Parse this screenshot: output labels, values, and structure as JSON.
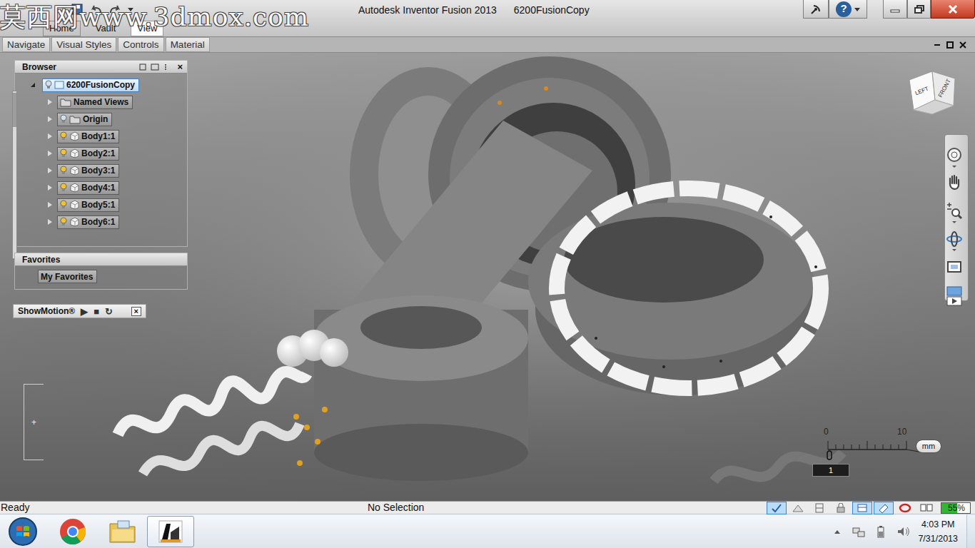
{
  "watermark": "莫西网www.3dmox.com",
  "window": {
    "app_title": "Autodesk Inventor Fusion 2013",
    "document": "6200FusionCopy",
    "help": "?"
  },
  "ribbon_tabs": [
    {
      "label": "Home",
      "selected": false
    },
    {
      "label": "Vault",
      "selected": false
    },
    {
      "label": "View",
      "selected": true
    }
  ],
  "panel_tabs": [
    "Navigate",
    "Visual Styles",
    "Controls",
    "Material"
  ],
  "browser": {
    "title": "Browser",
    "close": "×",
    "root": {
      "label": "6200FusionCopy",
      "expanded": true,
      "selected": true,
      "visible": false
    },
    "items": [
      {
        "label": "Named Views",
        "kind": "folder",
        "expanded": false,
        "selected": false
      },
      {
        "label": "Origin",
        "kind": "folder",
        "expanded": false,
        "selected": false,
        "visible": false
      },
      {
        "label": "Body1:1",
        "kind": "body",
        "expanded": false,
        "selected": false,
        "visible": true
      },
      {
        "label": "Body2:1",
        "kind": "body",
        "expanded": false,
        "selected": false,
        "visible": true
      },
      {
        "label": "Body3:1",
        "kind": "body",
        "expanded": false,
        "selected": false,
        "visible": true
      },
      {
        "label": "Body4:1",
        "kind": "body",
        "expanded": false,
        "selected": false,
        "visible": true
      },
      {
        "label": "Body5:1",
        "kind": "body",
        "expanded": false,
        "selected": false,
        "visible": true
      },
      {
        "label": "Body6:1",
        "kind": "body",
        "expanded": false,
        "selected": false,
        "visible": true
      }
    ]
  },
  "favorites": {
    "title": "Favorites",
    "items": [
      "My Favorites"
    ]
  },
  "showmotion": {
    "title": "ShowMotion®",
    "buttons": [
      "▶",
      "■",
      "↻"
    ],
    "close": "×",
    "track_mark": "+"
  },
  "view_cube": {
    "faces": [
      "LEFT",
      "FRONT"
    ]
  },
  "scale_bar": {
    "ticks": [
      "0",
      "10"
    ],
    "unit": "mm",
    "value": "1"
  },
  "status_bar": {
    "left": "Ready",
    "center": "No Selection",
    "tools": [
      {
        "selected": true
      },
      {
        "selected": false
      },
      {
        "selected": false
      },
      {
        "selected": false
      },
      {
        "selected": true
      },
      {
        "selected": true
      },
      {
        "selected": false
      },
      {
        "selected": false
      }
    ],
    "battery": {
      "reading": "55%",
      "level": 0.55
    }
  },
  "taskbar": {
    "time": "4:03 PM",
    "date": "7/31/2013"
  }
}
